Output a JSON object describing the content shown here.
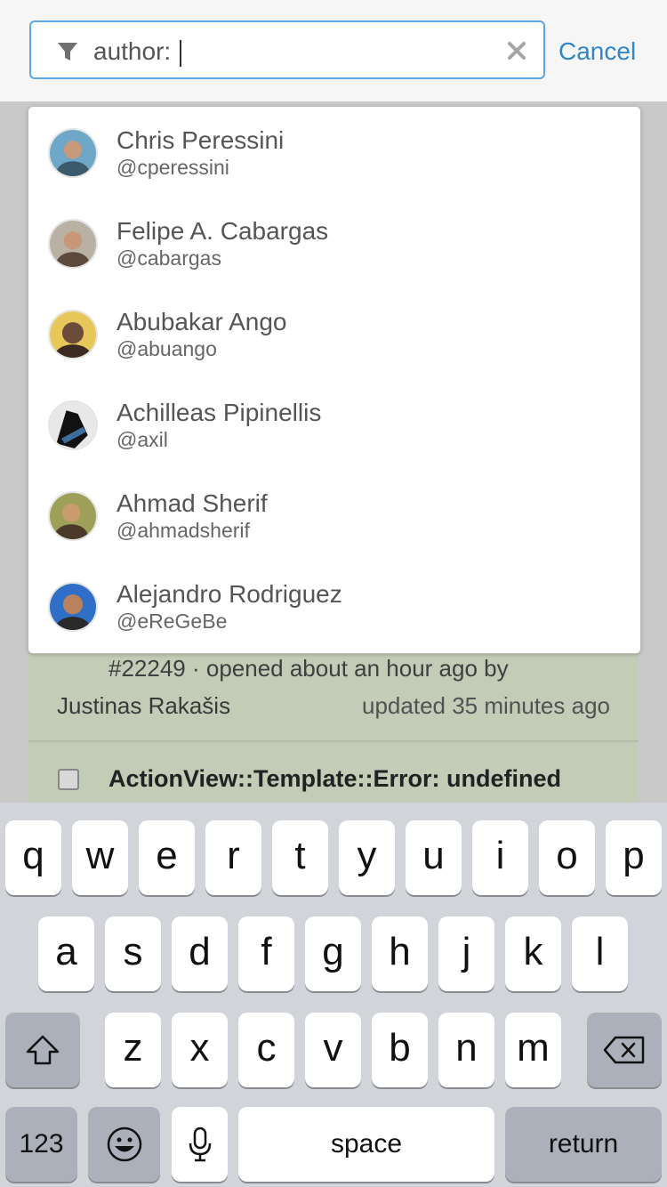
{
  "search": {
    "value": "author: ",
    "cancel_label": "Cancel"
  },
  "users": [
    {
      "name": "Chris Peressini",
      "handle": "@cperessini",
      "avatar_colors": [
        "#6fa7c9",
        "#3b5b6d",
        "#c89a7c"
      ]
    },
    {
      "name": "Felipe A. Cabargas",
      "handle": "@cabargas",
      "avatar_colors": [
        "#b9b2a4",
        "#5b4a3c",
        "#c8977a"
      ]
    },
    {
      "name": "Abubakar Ango",
      "handle": "@abuango",
      "avatar_colors": [
        "#e8c75a",
        "#3a2a22",
        "#6b4b3a"
      ]
    },
    {
      "name": "Achilleas Pipinellis",
      "handle": "@axil",
      "avatar_colors": [
        "#3d6f9c",
        "#111111",
        "#e8e8e8"
      ]
    },
    {
      "name": "Ahmad Sherif",
      "handle": "@ahmadsherif",
      "avatar_colors": [
        "#9ea05a",
        "#4b3a2a",
        "#c99c6e"
      ]
    },
    {
      "name": "Alejandro Rodriguez",
      "handle": "@eReGeBe",
      "avatar_colors": [
        "#2f6fc7",
        "#2a2a2a",
        "#b8825e"
      ]
    }
  ],
  "issue": {
    "meta": "#22249 · opened about an hour ago by",
    "author": "Justinas Rakašis",
    "updated": "updated 35 minutes ago",
    "title": "ActionView::Template::Error: undefined"
  },
  "keyboard": {
    "row1": [
      "q",
      "w",
      "e",
      "r",
      "t",
      "y",
      "u",
      "i",
      "o",
      "p"
    ],
    "row2": [
      "a",
      "s",
      "d",
      "f",
      "g",
      "h",
      "j",
      "k",
      "l"
    ],
    "row3": [
      "z",
      "x",
      "c",
      "v",
      "b",
      "n",
      "m"
    ],
    "numbers_label": "123",
    "space_label": "space",
    "return_label": "return",
    "icons": [
      "shift-icon",
      "backspace-icon",
      "emoji-icon",
      "microphone-icon"
    ]
  },
  "colors": {
    "accent": "#2f86c9",
    "focus_border": "#5aa7e6",
    "issue_bg": "#c2ccb6"
  }
}
